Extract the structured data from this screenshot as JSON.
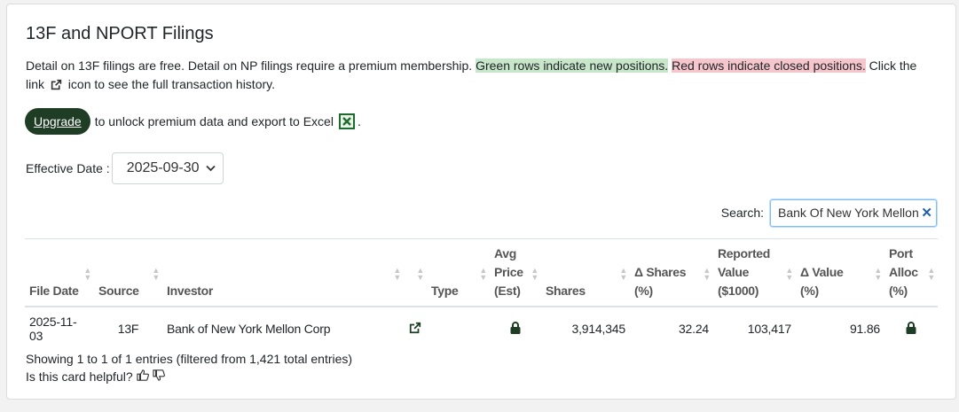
{
  "card": {
    "title": "13F and NPORT Filings",
    "desc_part1": "Detail on 13F filings are free. Detail on NP filings require a premium membership. ",
    "desc_green": "Green rows indicate new positions.",
    "desc_red": "Red rows indicate closed positions.",
    "desc_part2": " Click the link ",
    "desc_part3": " icon to see the full transaction history.",
    "upgrade_label": "Upgrade",
    "upgrade_text": "to unlock premium data and export to Excel",
    "upgrade_period": ".",
    "effective_date_label": "Effective Date :",
    "effective_date_value": "2025-09-30",
    "search_label": "Search:",
    "search_value": "Bank Of New York Mellon",
    "footer_info": "Showing 1 to 1 of 1 entries (filtered from 1,421 total entries)",
    "helpful_label": "Is this card helpful?"
  },
  "colors": {
    "accent": "#1e3d24",
    "new_position": "#c8e6c9",
    "closed_position": "#f5c6cb",
    "link": "#1e3d24"
  },
  "table": {
    "headers": {
      "file_date": "File Date",
      "source": "Source",
      "investor": "Investor",
      "type": "Type",
      "avg_price_1": "Avg",
      "avg_price_2": "Price",
      "avg_price_3": "(Est)",
      "shares": "Shares",
      "delta_shares_1": "Δ Shares",
      "delta_shares_2": "(%)",
      "reported_value_1": "Reported",
      "reported_value_2": "Value",
      "reported_value_3": "($1000)",
      "delta_value_1": "Δ Value",
      "delta_value_2": "(%)",
      "port_alloc_1": "Port",
      "port_alloc_2": "Alloc",
      "port_alloc_3": "(%)"
    },
    "rows": [
      {
        "file_date": "2025-11-03",
        "source": "13F",
        "investor": "Bank of New York Mellon Corp",
        "link_icon": "external-link-icon",
        "type": "",
        "avg_price_icon": "lock-icon",
        "shares": "3,914,345",
        "delta_shares": "32.24",
        "reported_value": "103,417",
        "delta_value": "91.86",
        "port_alloc_icon": "lock-icon"
      }
    ]
  },
  "icons": {
    "external_link": "external-link-icon",
    "excel": "excel-icon",
    "dropdown": "chevron-down-icon",
    "clear": "clear-icon",
    "lock": "lock-icon",
    "thumbs_up": "thumbs-up-icon",
    "thumbs_down": "thumbs-down-icon",
    "sort": "sort-icon"
  }
}
